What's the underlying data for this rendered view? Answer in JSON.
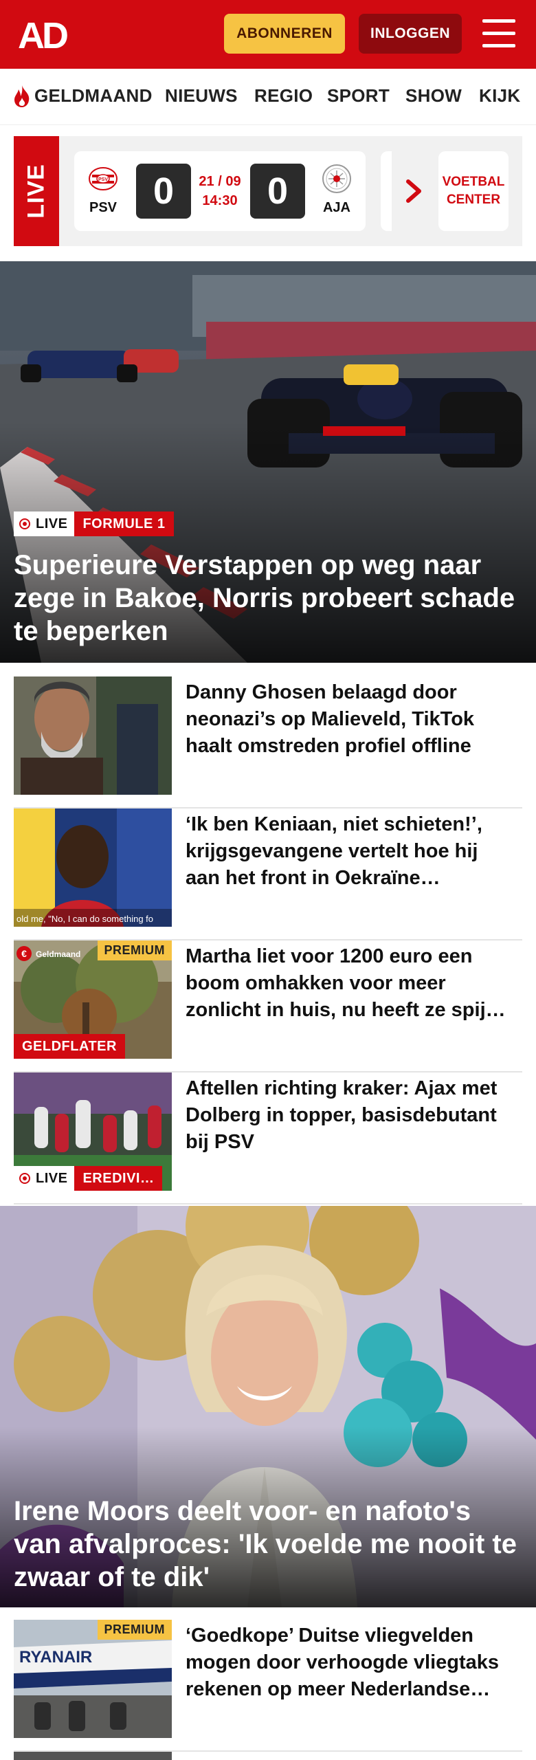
{
  "header": {
    "logo_text": "AD",
    "subscribe_label": "ABONNEREN",
    "login_label": "INLOGGEN",
    "colors": {
      "brand_red": "#d10a11",
      "subscribe_yellow": "#f6c343",
      "login_dark_red": "#8e0a0e"
    }
  },
  "nav": {
    "items": [
      {
        "label": "GELDMAAND",
        "icon": "flame-icon"
      },
      {
        "label": "NIEUWS"
      },
      {
        "label": "REGIO"
      },
      {
        "label": "SPORT"
      },
      {
        "label": "SHOW"
      },
      {
        "label": "KIJK"
      }
    ]
  },
  "live_widget": {
    "tab_label": "LIVE",
    "match": {
      "home": {
        "name": "PSV",
        "score": "0"
      },
      "away": {
        "name": "AJA",
        "score": "0"
      },
      "date": "21 / 09",
      "time": "14:30"
    },
    "football_center_label": "VOETBAL CENTER"
  },
  "hero": {
    "live_label": "LIVE",
    "category": "FORMULE 1",
    "title": "Superieure Verstappen op weg naar zege in Bakoe, Norris probeert schade te beperken"
  },
  "articles": [
    {
      "title": "Danny Ghosen belaagd door neonazi’s op Malieveld, TikTok haalt omstreden profiel offline"
    },
    {
      "title": "‘Ik ben Keniaan, niet schieten!’, krijgsgevangene vertelt hoe hij aan het front in Oekraïne…",
      "caption": "old me, \"No, I can do something fo"
    },
    {
      "title": "Martha liet voor 1200 euro een boom omhakken voor meer zonlicht in huis, nu heeft ze spij…",
      "premium": "PREMIUM",
      "category": "GELDFLATER",
      "brand_label": "Geldmaand"
    },
    {
      "title": "Aftellen richting kraker: Ajax met Dolberg in topper, basisdebutant bij PSV",
      "live_label": "LIVE",
      "category": "EREDIVI…"
    }
  ],
  "feature": {
    "title": "Irene Moors deelt voor- en nafoto's van afvalproces: 'Ik voelde me nooit te zwaar of te dik'"
  },
  "articles_2": [
    {
      "title": "‘Goedkope’ Duitse vliegvelden mogen door verhoogde vliegtaks rekenen op meer Nederlandse…",
      "premium": "PREMIUM",
      "plane_text": "RYANAIR"
    }
  ]
}
